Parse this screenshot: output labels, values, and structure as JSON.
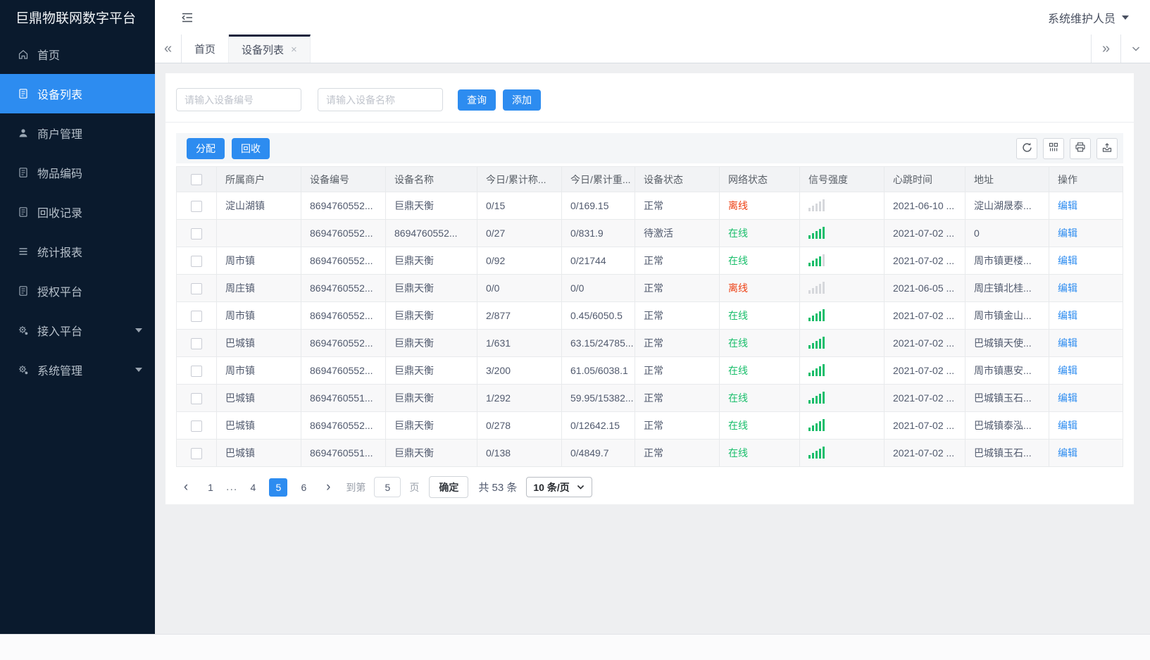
{
  "app": {
    "title": "巨鼎物联网数字平台",
    "user_name": "系统维护人员"
  },
  "sidebar": {
    "items": [
      {
        "id": "home",
        "label": "首页",
        "icon": "home-icon",
        "active": false,
        "expandable": false
      },
      {
        "id": "device-list",
        "label": "设备列表",
        "icon": "document-icon",
        "active": true,
        "expandable": false
      },
      {
        "id": "merchant-management",
        "label": "商户管理",
        "icon": "user-icon",
        "active": false,
        "expandable": false
      },
      {
        "id": "item-code",
        "label": "物品编码",
        "icon": "document-icon",
        "active": false,
        "expandable": false
      },
      {
        "id": "recycle-records",
        "label": "回收记录",
        "icon": "document-icon",
        "active": false,
        "expandable": false
      },
      {
        "id": "statistics-report",
        "label": "统计报表",
        "icon": "list-icon",
        "active": false,
        "expandable": false
      },
      {
        "id": "authorized-platform",
        "label": "授权平台",
        "icon": "document-icon",
        "active": false,
        "expandable": false
      },
      {
        "id": "access-platform",
        "label": "接入平台",
        "icon": "gear-icon",
        "active": false,
        "expandable": true
      },
      {
        "id": "system-management",
        "label": "系统管理",
        "icon": "gear-icon",
        "active": false,
        "expandable": true
      }
    ]
  },
  "tabs": [
    {
      "id": "home",
      "label": "首页",
      "active": false,
      "closable": false
    },
    {
      "id": "device-list",
      "label": "设备列表",
      "active": true,
      "closable": true
    }
  ],
  "search": {
    "device_no_placeholder": "请输入设备编号",
    "device_name_placeholder": "请输入设备名称",
    "query_label": "查询",
    "add_label": "添加"
  },
  "toolbar": {
    "assign_label": "分配",
    "recycle_label": "回收"
  },
  "table": {
    "columns": [
      "所属商户",
      "设备编号",
      "设备名称",
      "今日/累计称...",
      "今日/累计重...",
      "设备状态",
      "网络状态",
      "信号强度",
      "心跳时间",
      "地址",
      "操作"
    ],
    "edit_label": "编辑",
    "rows": [
      {
        "merchant": "淀山湖镇",
        "device_no": "8694760552...",
        "device_name": "巨鼎天衡",
        "today_count": "0/15",
        "today_weight": "0/169.15",
        "device_status": "正常",
        "network_status": "离线",
        "signal": 0,
        "heartbeat": "2021-06-10 ...",
        "address": "淀山湖晟泰..."
      },
      {
        "merchant": "",
        "device_no": "8694760552...",
        "device_name": "8694760552...",
        "today_count": "0/27",
        "today_weight": "0/831.9",
        "device_status": "待激活",
        "network_status": "在线",
        "signal": 5,
        "heartbeat": "2021-07-02 ...",
        "address": "0"
      },
      {
        "merchant": "周市镇",
        "device_no": "8694760552...",
        "device_name": "巨鼎天衡",
        "today_count": "0/92",
        "today_weight": "0/21744",
        "device_status": "正常",
        "network_status": "在线",
        "signal": 4,
        "heartbeat": "2021-07-02 ...",
        "address": "周市镇更楼..."
      },
      {
        "merchant": "周庄镇",
        "device_no": "8694760552...",
        "device_name": "巨鼎天衡",
        "today_count": "0/0",
        "today_weight": "0/0",
        "device_status": "正常",
        "network_status": "离线",
        "signal": 0,
        "heartbeat": "2021-06-05 ...",
        "address": "周庄镇北桂..."
      },
      {
        "merchant": "周市镇",
        "device_no": "8694760552...",
        "device_name": "巨鼎天衡",
        "today_count": "2/877",
        "today_weight": "0.45/6050.5",
        "device_status": "正常",
        "network_status": "在线",
        "signal": 5,
        "heartbeat": "2021-07-02 ...",
        "address": "周市镇金山..."
      },
      {
        "merchant": "巴城镇",
        "device_no": "8694760552...",
        "device_name": "巨鼎天衡",
        "today_count": "1/631",
        "today_weight": "63.15/24785...",
        "device_status": "正常",
        "network_status": "在线",
        "signal": 5,
        "heartbeat": "2021-07-02 ...",
        "address": "巴城镇天使..."
      },
      {
        "merchant": "周市镇",
        "device_no": "8694760552...",
        "device_name": "巨鼎天衡",
        "today_count": "3/200",
        "today_weight": "61.05/6038.1",
        "device_status": "正常",
        "network_status": "在线",
        "signal": 5,
        "heartbeat": "2021-07-02 ...",
        "address": "周市镇惠安..."
      },
      {
        "merchant": "巴城镇",
        "device_no": "8694760551...",
        "device_name": "巨鼎天衡",
        "today_count": "1/292",
        "today_weight": "59.95/15382...",
        "device_status": "正常",
        "network_status": "在线",
        "signal": 5,
        "heartbeat": "2021-07-02 ...",
        "address": "巴城镇玉石..."
      },
      {
        "merchant": "巴城镇",
        "device_no": "8694760552...",
        "device_name": "巨鼎天衡",
        "today_count": "0/278",
        "today_weight": "0/12642.15",
        "device_status": "正常",
        "network_status": "在线",
        "signal": 5,
        "heartbeat": "2021-07-02 ...",
        "address": "巴城镇泰泓..."
      },
      {
        "merchant": "巴城镇",
        "device_no": "8694760551...",
        "device_name": "巨鼎天衡",
        "today_count": "0/138",
        "today_weight": "0/4849.7",
        "device_status": "正常",
        "network_status": "在线",
        "signal": 5,
        "heartbeat": "2021-07-02 ...",
        "address": "巴城镇玉石..."
      }
    ]
  },
  "pagination": {
    "prev_label": "‹",
    "next_label": "›",
    "pages": [
      {
        "label": "1"
      },
      {
        "label": "...",
        "ellipsis": true
      },
      {
        "label": "4"
      },
      {
        "label": "5",
        "active": true
      },
      {
        "label": "6"
      }
    ],
    "goto_prefix": "到第",
    "goto_value": "5",
    "goto_suffix": "页",
    "confirm_label": "确定",
    "total_label": "共 53 条",
    "page_size_label": "10 条/页"
  },
  "colors": {
    "primary": "#2d8cf0",
    "success": "#19be6b",
    "danger": "#ed4014",
    "sidebar_bg": "#0a1a2d"
  }
}
